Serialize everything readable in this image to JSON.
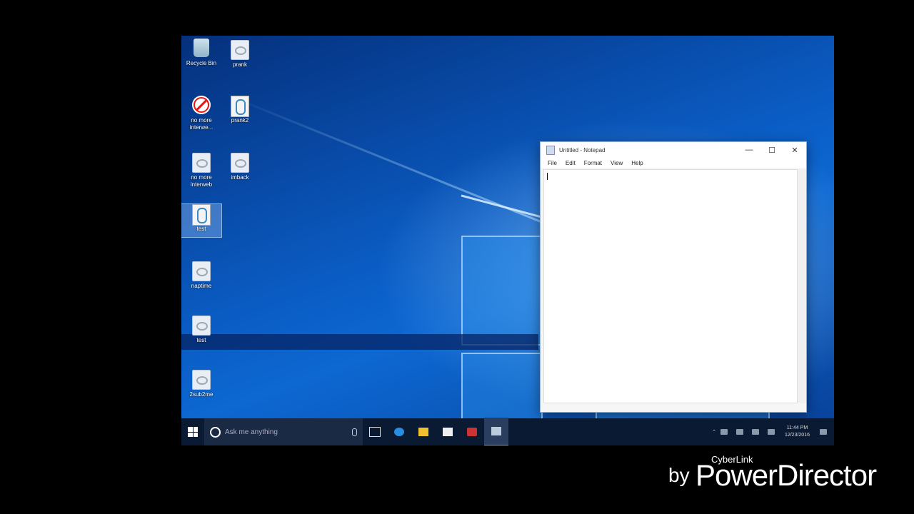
{
  "desktop": {
    "icons": [
      {
        "label": "Recycle Bin",
        "icon": "recycle-bin-icon"
      },
      {
        "label": "prank",
        "icon": "file-icon"
      },
      {
        "label": "no more interwe...",
        "icon": "no-entry-shortcut-icon"
      },
      {
        "label": "prank2",
        "icon": "script-icon"
      },
      {
        "label": "no more interweb",
        "icon": "file-icon"
      },
      {
        "label": "imback",
        "icon": "file-icon"
      },
      {
        "label": "test",
        "icon": "script-icon"
      },
      {
        "label": "naptime",
        "icon": "file-icon"
      },
      {
        "label": "test",
        "icon": "file-icon"
      },
      {
        "label": "2sub2me",
        "icon": "file-icon"
      }
    ]
  },
  "notepad": {
    "title": "Untitled - Notepad",
    "menu": [
      "File",
      "Edit",
      "Format",
      "View",
      "Help"
    ],
    "content": ""
  },
  "taskbar": {
    "search_placeholder": "Ask me anything",
    "time": "11:44 PM",
    "date": "12/23/2016"
  },
  "watermark": {
    "by": "by",
    "brand_small": "CyberLink",
    "brand_large": "PowerDirector"
  },
  "colors": {
    "wallpaper_accent": "#0a5bc2",
    "taskbar": "#0b1a33"
  }
}
